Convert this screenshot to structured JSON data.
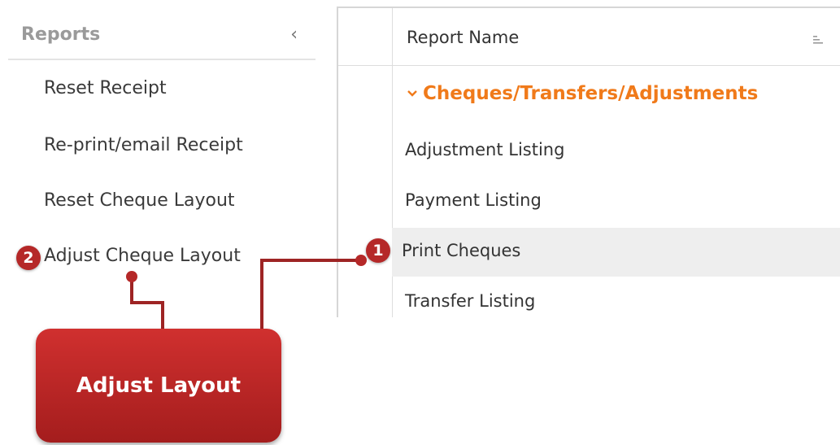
{
  "sidebar": {
    "title": "Reports",
    "collapse_icon": "chevron-left-icon",
    "items": [
      {
        "label": "Reset Receipt"
      },
      {
        "label": "Re-print/email Receipt"
      },
      {
        "label": "Reset Cheque Layout"
      },
      {
        "label": "Adjust Cheque Layout",
        "badge": "2"
      }
    ]
  },
  "grid": {
    "header": "Report Name",
    "sort_icon": "sort-icon",
    "group": {
      "label": "Cheques/Transfers/Adjustments",
      "chevron": "chevron-down-icon",
      "color": "#f07a1a"
    },
    "rows": [
      {
        "label": "Adjustment Listing"
      },
      {
        "label": "Payment Listing"
      },
      {
        "label": "Print Cheques",
        "badge": "1",
        "selected": true
      },
      {
        "label": "Transfer Listing"
      }
    ]
  },
  "callout": {
    "label": "Adjust Layout"
  },
  "colors": {
    "accent_red": "#b52828",
    "group_orange": "#f07a1a",
    "selected_row": "#eeeeee"
  }
}
